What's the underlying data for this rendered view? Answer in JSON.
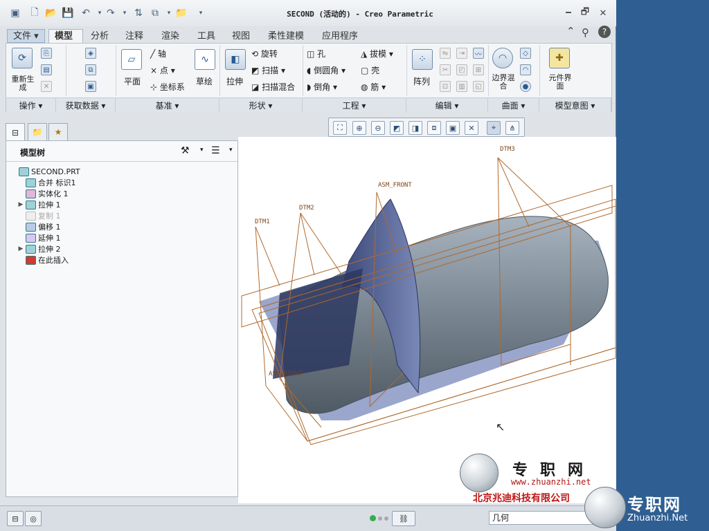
{
  "window": {
    "title": "SECOND (活动的) - Creo Parametric"
  },
  "tabs": [
    "文件",
    "模型",
    "分析",
    "注释",
    "渲染",
    "工具",
    "视图",
    "柔性建模",
    "应用程序"
  ],
  "ribbon": {
    "regen": "重新生成",
    "plane": "平面",
    "axis": "轴",
    "point": "点",
    "csys": "坐标系",
    "sketch": "草绘",
    "extrude": "拉伸",
    "revolve": "旋转",
    "sweep": "扫描",
    "swept_blend": "扫描混合",
    "hole": "孔",
    "draft": "拔模",
    "round": "倒圆角",
    "shell": "壳",
    "chamfer": "倒角",
    "rib": "筋",
    "pattern": "阵列",
    "boundary_blend": "边界混合",
    "component_interface": "元件界面"
  },
  "groups": [
    "操作",
    "获取数据",
    "基准",
    "形状",
    "工程",
    "编辑",
    "曲面",
    "模型意图"
  ],
  "tree": {
    "title": "模型树",
    "items": [
      {
        "label": "SECOND.PRT",
        "level": 0,
        "arrow": ""
      },
      {
        "label": "合并 标识1",
        "level": 1,
        "arrow": ""
      },
      {
        "label": "实体化 1",
        "level": 1,
        "arrow": ""
      },
      {
        "label": "拉伸 1",
        "level": 1,
        "arrow": "▶"
      },
      {
        "label": "复制 1",
        "level": 1,
        "arrow": "",
        "disabled": true
      },
      {
        "label": "偏移 1",
        "level": 1,
        "arrow": ""
      },
      {
        "label": "延伸 1",
        "level": 1,
        "arrow": ""
      },
      {
        "label": "拉伸 2",
        "level": 1,
        "arrow": "▶"
      },
      {
        "label": "在此插入",
        "level": 1,
        "arrow": ""
      }
    ]
  },
  "datums": [
    "DTM1",
    "DTM2",
    "ASM_FRONT",
    "DTM3",
    "ASM_RIGHT"
  ],
  "status": {
    "filter": "几何"
  },
  "watermark": {
    "name": "专职网",
    "url": "www.zhuanzhi.net",
    "company": "北京兆迪科技有限公司",
    "side_name": "专职网",
    "side_url": "Zhuanzhi.Net"
  },
  "colors": {
    "accent": "#2f5f92",
    "datum": "#b0692c",
    "model": "#8f9aa6"
  }
}
